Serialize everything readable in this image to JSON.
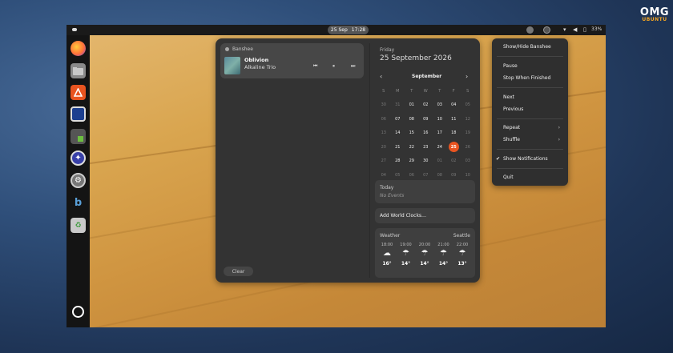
{
  "logo": {
    "line1": "OMG",
    "line2": "UBUNTU"
  },
  "topbar": {
    "date": "25 Sep",
    "time": "17:28",
    "battery": "33%",
    "icons": [
      "activities-indicator",
      "banshee-indicator",
      "extension-indicator",
      "network-icon",
      "volume-icon",
      "battery-icon"
    ]
  },
  "dock": {
    "apps": [
      "firefox-icon",
      "files-icon",
      "software-center-icon",
      "screen-app-icon",
      "terminal-app-icon",
      "compass-icon",
      "settings-icon",
      "banshee-icon",
      "trash-icon",
      "show-apps-icon"
    ]
  },
  "media": {
    "app_name": "Banshee",
    "title": "Oblivion",
    "artist": "Alkaline Trio",
    "prev": "⏮",
    "pause": "⏸",
    "next": "⏭"
  },
  "clear_label": "Clear",
  "calendar": {
    "day_name": "Friday",
    "full_date": "25 September 2026",
    "month": "September",
    "prev": "‹",
    "next": "›",
    "weekdays": [
      "S",
      "M",
      "T",
      "W",
      "T",
      "F",
      "S"
    ],
    "weeks": [
      [
        "30",
        "31",
        "01",
        "02",
        "03",
        "04",
        "05"
      ],
      [
        "06",
        "07",
        "08",
        "09",
        "10",
        "11",
        "12"
      ],
      [
        "13",
        "14",
        "15",
        "16",
        "17",
        "18",
        "19"
      ],
      [
        "20",
        "21",
        "22",
        "23",
        "24",
        "25",
        "26"
      ],
      [
        "27",
        "28",
        "29",
        "30",
        "01",
        "02",
        "03"
      ],
      [
        "04",
        "05",
        "06",
        "07",
        "08",
        "09",
        "10"
      ]
    ],
    "today": "25"
  },
  "events": {
    "title": "Today",
    "empty": "No Events"
  },
  "world_clocks_label": "Add World Clocks…",
  "weather": {
    "title": "Weather",
    "location": "Seattle",
    "hours": [
      {
        "time": "18:00",
        "icon": "☁",
        "temp": "16°"
      },
      {
        "time": "19:00",
        "icon": "☂",
        "temp": "14°"
      },
      {
        "time": "20:00",
        "icon": "☂",
        "temp": "14°"
      },
      {
        "time": "21:00",
        "icon": "☂",
        "temp": "14°"
      },
      {
        "time": "22:00",
        "icon": "☂",
        "temp": "13°"
      }
    ]
  },
  "menu": {
    "show_hide": "Show/Hide Banshee",
    "pause": "Pause",
    "stop_when_finished": "Stop When Finished",
    "next": "Next",
    "previous": "Previous",
    "repeat": "Repeat",
    "shuffle": "Shuffle",
    "show_notifications": "Show Notifications",
    "quit": "Quit",
    "check": "✔",
    "arrow": "›"
  },
  "colors": {
    "accent": "#e95420",
    "panel": "#333333",
    "menu": "#2f2f2f"
  }
}
